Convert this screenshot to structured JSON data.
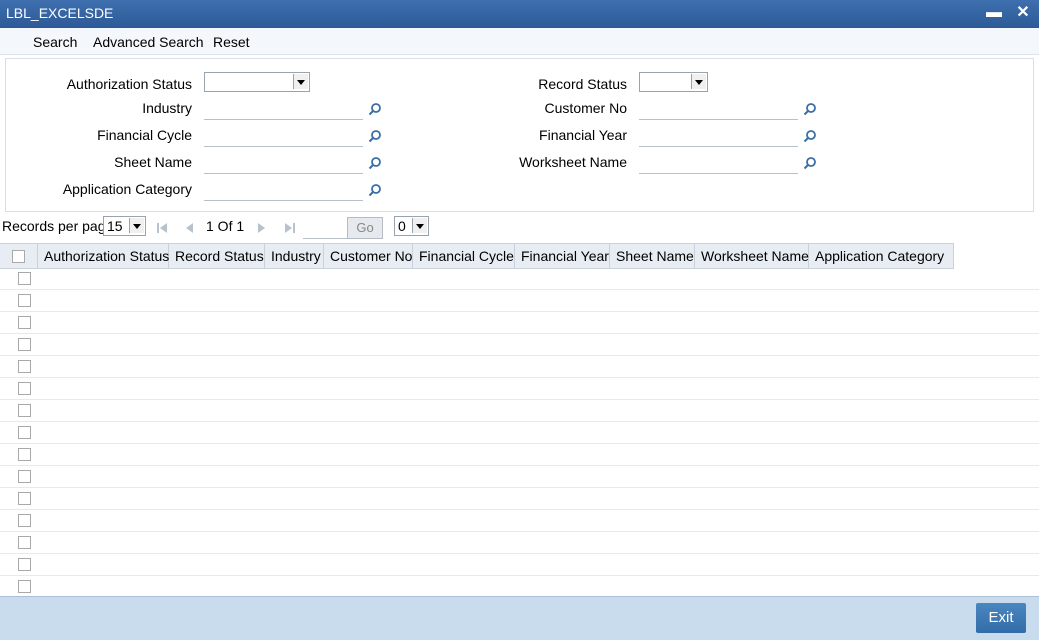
{
  "window": {
    "title": "LBL_EXCELSDE",
    "minimize": "▬",
    "close": "✕"
  },
  "menu": {
    "search": "Search",
    "advanced_search": "Advanced Search",
    "reset": "Reset"
  },
  "criteria": {
    "authorization_status": {
      "label": "Authorization Status",
      "value": ""
    },
    "record_status": {
      "label": "Record Status",
      "value": ""
    },
    "industry": {
      "label": "Industry",
      "value": ""
    },
    "customer_no": {
      "label": "Customer No",
      "value": ""
    },
    "financial_cycle": {
      "label": "Financial Cycle",
      "value": ""
    },
    "financial_year": {
      "label": "Financial Year",
      "value": ""
    },
    "sheet_name": {
      "label": "Sheet Name",
      "value": ""
    },
    "worksheet_name": {
      "label": "Worksheet Name",
      "value": ""
    },
    "application_category": {
      "label": "Application Category",
      "value": ""
    }
  },
  "pager": {
    "records_label": "Records per page",
    "records_value": "15",
    "page_text": "1 Of 1",
    "go_label": "Go",
    "page_select": "0"
  },
  "grid": {
    "columns": [
      "Authorization Status",
      "Record Status",
      "Industry",
      "Customer No",
      "Financial Cycle",
      "Financial Year",
      "Sheet Name",
      "Worksheet Name",
      "Application Category"
    ],
    "row_count": 15
  },
  "footer": {
    "exit_label": "Exit"
  },
  "colors": {
    "titlebar": "#2d5a97",
    "footer": "#c8dcee",
    "exit_button": "#336da7"
  }
}
